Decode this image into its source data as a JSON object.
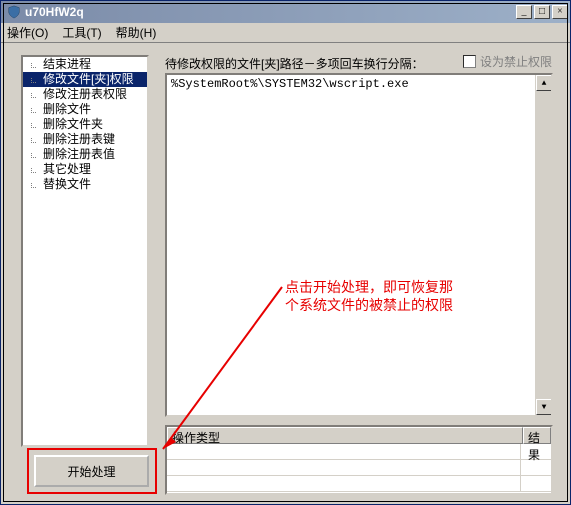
{
  "window": {
    "title": "u70HfW2q"
  },
  "menu": {
    "m1": "操作(O)",
    "m2": "工具(T)",
    "m3": "帮助(H)"
  },
  "sidebar": {
    "items": [
      {
        "label": "结束进程"
      },
      {
        "label": "修改文件[夹]权限"
      },
      {
        "label": "修改注册表权限"
      },
      {
        "label": "删除文件"
      },
      {
        "label": "删除文件夹"
      },
      {
        "label": "删除注册表键"
      },
      {
        "label": "删除注册表值"
      },
      {
        "label": "其它处理"
      },
      {
        "label": "替换文件"
      }
    ]
  },
  "labels": {
    "paths_caption": "待修改权限的文件[夹]路径－多项回车换行分隔：",
    "checkbox_deny": "设为禁止权限"
  },
  "path_text": "%SystemRoot%\\SYSTEM32\\wscript.exe",
  "grid": {
    "col1": "操作类型",
    "col2": "结果"
  },
  "button": {
    "start": "开始处理"
  },
  "annotation": {
    "text": "点击开始处理，即可恢复那个系统文件的被禁止的权限"
  }
}
